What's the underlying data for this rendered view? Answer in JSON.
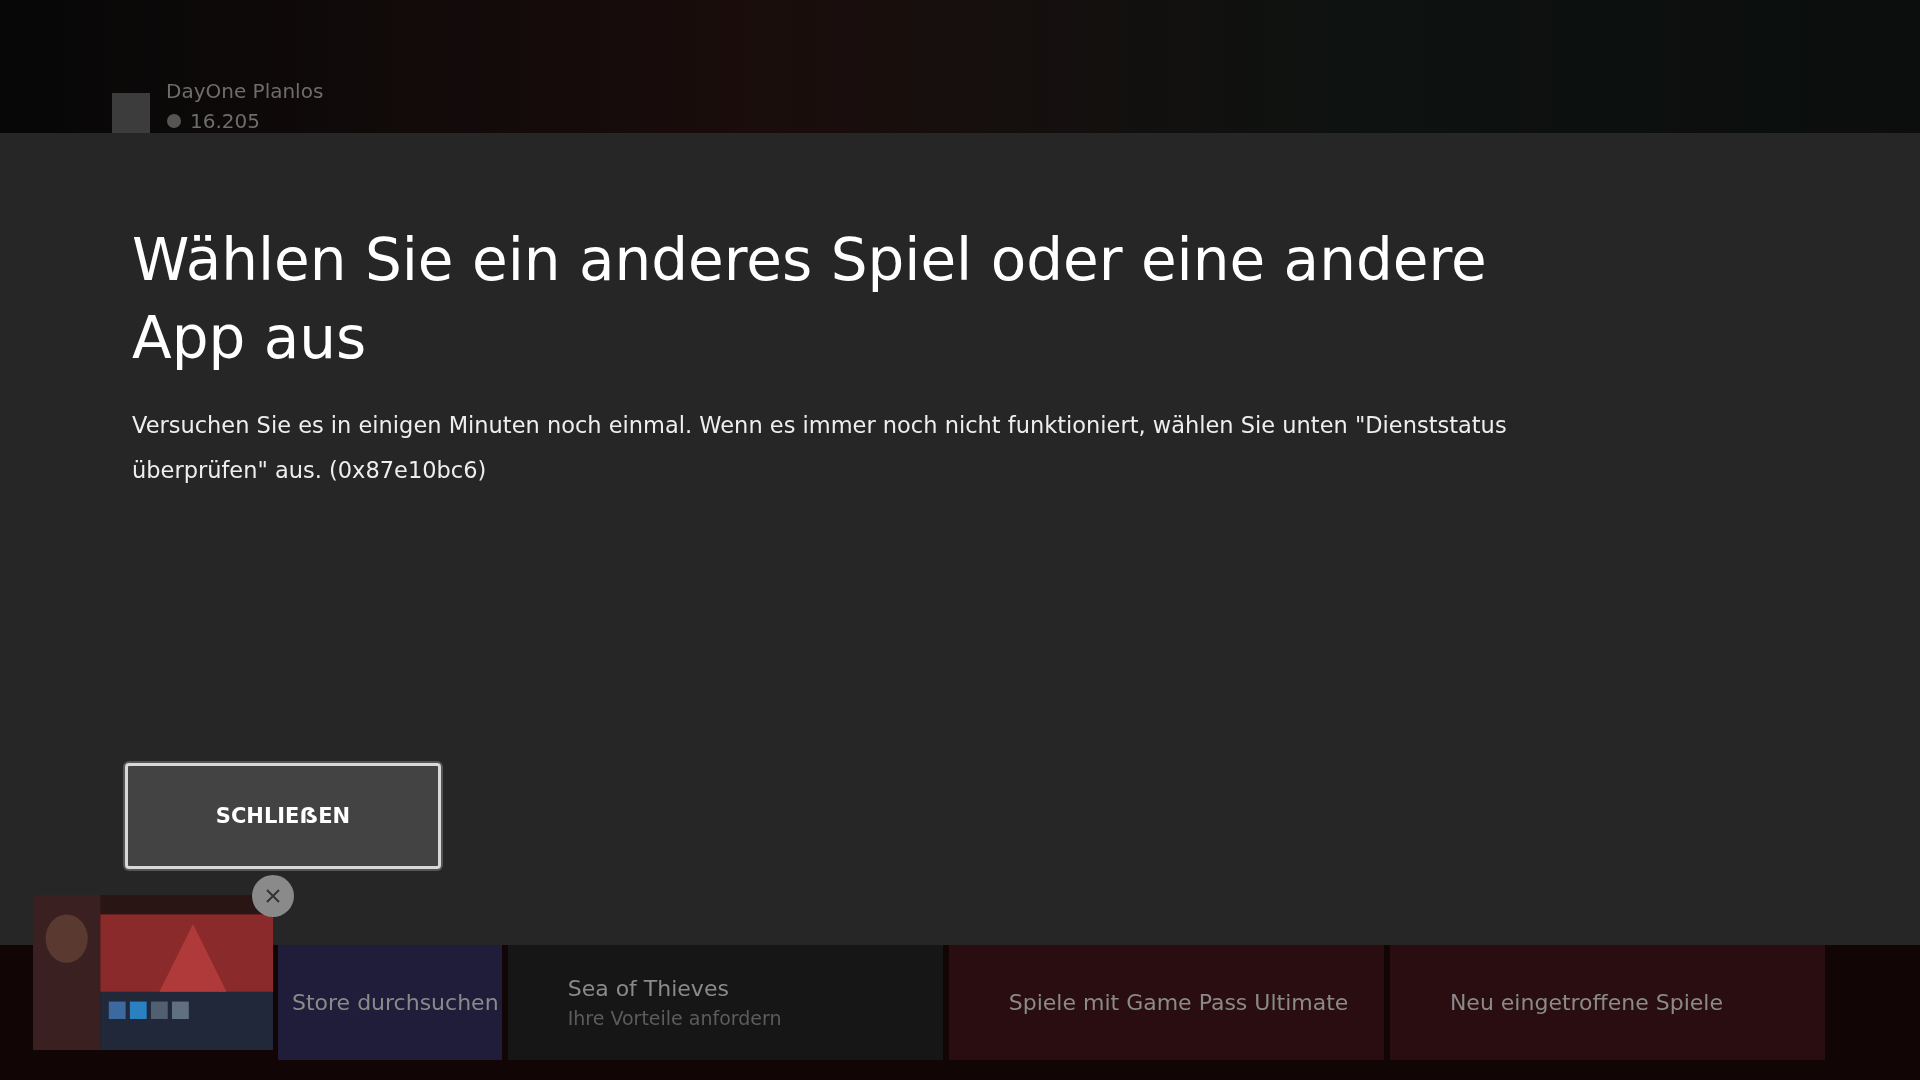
{
  "profile": {
    "name": "DayOne Planlos",
    "gamerscore": "16.205"
  },
  "dialog": {
    "title": "Wählen Sie ein anderes Spiel oder eine andere App aus",
    "message": "Versuchen Sie es in einigen Minuten noch einmal. Wenn es immer noch nicht funktioniert, wählen Sie unten \"Dienststatus überprüfen\" aus. (0x87e10bc6)",
    "buttons": [
      {
        "label": "SCHLIEẞEN",
        "selected": true
      }
    ]
  },
  "tiles": [
    {
      "title": "Store durchsuchen",
      "kind": "store"
    },
    {
      "title": "Sea of Thieves",
      "subtitle": "Ihre Vorteile anfordern",
      "kind": "game"
    },
    {
      "title": "Spiele mit Game Pass Ultimate",
      "kind": "promo"
    },
    {
      "title": "Neu eingetroffene Spiele",
      "kind": "promo"
    }
  ]
}
